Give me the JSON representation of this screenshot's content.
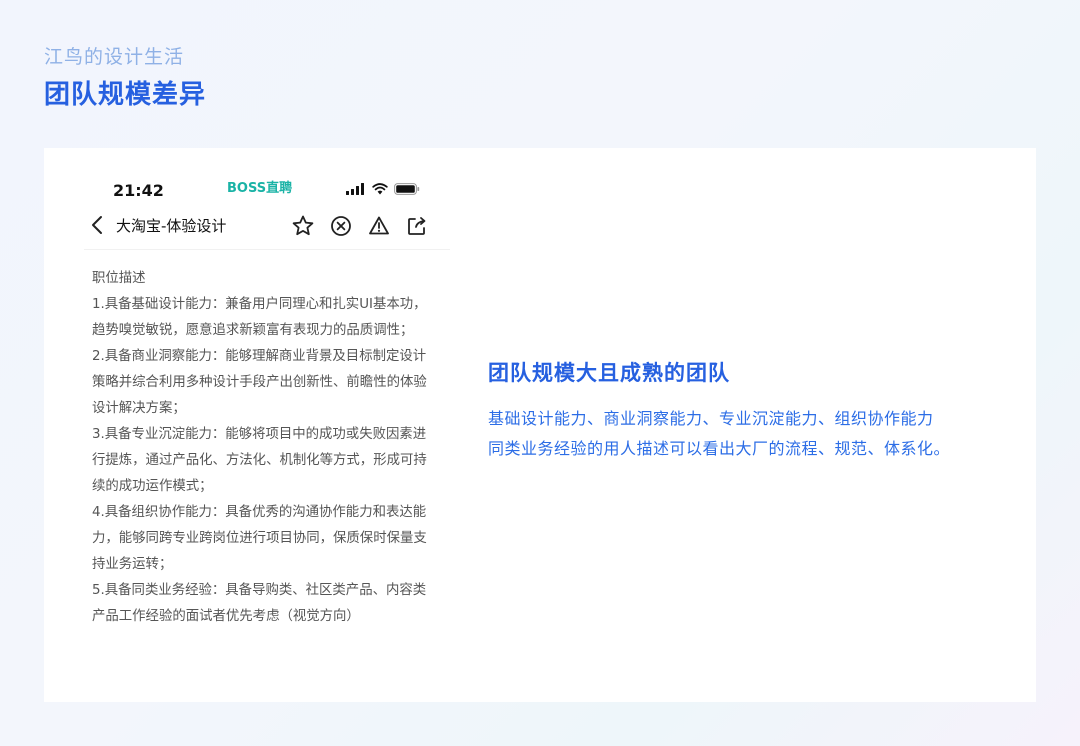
{
  "header": {
    "subtitle": "江鸟的设计生活",
    "title": "团队规模差异"
  },
  "phone": {
    "status_time": "21:42",
    "brand": "BOSS直聘",
    "nav_title": "大淘宝-体验设计"
  },
  "job_description": {
    "heading": "职位描述",
    "items": [
      "1.具备基础设计能力：兼备用户同理心和扎实UI基本功，趋势嗅觉敏锐，愿意追求新颖富有表现力的品质调性；",
      "2.具备商业洞察能力：能够理解商业背景及目标制定设计策略并综合利用多种设计手段产出创新性、前瞻性的体验设计解决方案；",
      "3.具备专业沉淀能力：能够将项目中的成功或失败因素进行提炼，通过产品化、方法化、机制化等方式，形成可持续的成功运作模式；",
      "4.具备组织协作能力：具备优秀的沟通协作能力和表达能力，能够同跨专业跨岗位进行项目协同，保质保时保量支持业务运转；",
      "5.具备同类业务经验：具备导购类、社区类产品、内容类产品工作经验的面试者优先考虑（视觉方向）"
    ]
  },
  "summary": {
    "title": "团队规模大且成熟的团队",
    "lines": [
      "基础设计能力、商业洞察能力、专业沉淀能力、组织协作能力",
      "同类业务经验的用人描述可以看出大厂的流程、规范、体系化。"
    ]
  },
  "colors": {
    "accent": "#2660e0",
    "brand": "#1ab3a6"
  }
}
